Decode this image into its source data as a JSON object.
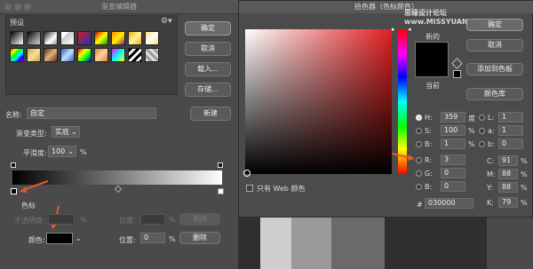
{
  "gradient_editor": {
    "title": "渐变编辑器",
    "presets_label": "预设",
    "buttons": {
      "ok": "确定",
      "cancel": "取消",
      "load": "载入...",
      "save": "存储...",
      "new": "新建",
      "delete": "删除"
    },
    "name_label": "名称:",
    "name_value": "自定",
    "type_label": "渐变类型:",
    "type_value": "实底",
    "smooth_label": "平滑度:",
    "smooth_value": "100",
    "percent": "%",
    "stops_label": "色标",
    "opacity_label": "不透明度:",
    "location_label": "位置:",
    "location_unit": "%",
    "color_label": "颜色:",
    "location_value": "0",
    "arrow_color": "#e25a2b"
  },
  "color_picker": {
    "title": "拾色器（色标颜色）",
    "watermark": "思缘设计论坛  www.MISSYUAN.COM",
    "new_label": "新的",
    "current_label": "当前",
    "buttons": {
      "ok": "确定",
      "cancel": "取消",
      "add_swatch": "添加到色板",
      "libraries": "颜色库"
    },
    "web_only_label": "只有 Web 颜色",
    "fields": {
      "H": {
        "label": "H:",
        "value": "359",
        "unit": "度"
      },
      "S": {
        "label": "S:",
        "value": "100",
        "unit": "%"
      },
      "B": {
        "label": "B:",
        "value": "1",
        "unit": "%"
      },
      "R": {
        "label": "R:",
        "value": "3"
      },
      "G": {
        "label": "G:",
        "value": "0"
      },
      "Bl": {
        "label": "B:",
        "value": "0"
      },
      "L": {
        "label": "L:",
        "value": "1"
      },
      "a": {
        "label": "a:",
        "value": "1"
      },
      "b": {
        "label": "b:",
        "value": "0"
      },
      "C": {
        "label": "C:",
        "value": "91",
        "unit": "%"
      },
      "M": {
        "label": "M:",
        "value": "88",
        "unit": "%"
      },
      "Y": {
        "label": "Y:",
        "value": "88",
        "unit": "%"
      },
      "K": {
        "label": "K:",
        "value": "79",
        "unit": "%"
      }
    },
    "hex_label": "#",
    "hex_value": "030000"
  }
}
